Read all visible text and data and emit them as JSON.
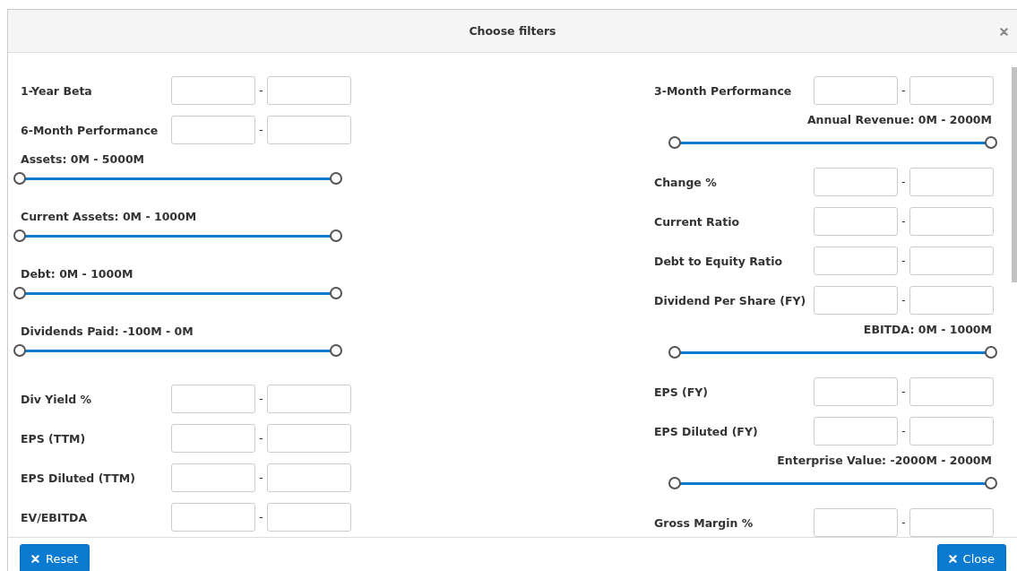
{
  "dialog": {
    "title": "Choose filters"
  },
  "columns": [
    {
      "filters": [
        {
          "kind": "range",
          "label": "1-Year Beta",
          "separator": "-"
        },
        {
          "kind": "range",
          "label": "6-Month Performance",
          "separator": "-"
        },
        {
          "kind": "slider",
          "label": "Assets: 0M - 5000M",
          "thumbs": [
            {
              "level": 0
            },
            {
              "level": 1
            }
          ]
        },
        {
          "kind": "slider",
          "label": "Current Assets: 0M - 1000M",
          "thumbs": [
            {
              "level": 0
            },
            {
              "level": 1
            }
          ]
        },
        {
          "kind": "slider",
          "label": "Debt: 0M - 1000M",
          "thumbs": [
            {
              "level": 0
            },
            {
              "level": 1
            }
          ]
        },
        {
          "kind": "slider",
          "label": "Dividends Paid: -100M - 0M",
          "thumbs": [
            {
              "level": 0
            },
            {
              "level": 1
            }
          ]
        },
        {
          "kind": "range",
          "label": "Div Yield %",
          "separator": "-"
        },
        {
          "kind": "range",
          "label": "EPS (TTM)",
          "separator": "-"
        },
        {
          "kind": "range",
          "label": "EPS Diluted (TTM)",
          "separator": "-"
        },
        {
          "kind": "range",
          "label": "EV/EBITDA",
          "separator": "-"
        }
      ]
    },
    {
      "filters": [
        {
          "kind": "range",
          "label": "3-Month Performance",
          "separator": "-"
        },
        {
          "kind": "slider",
          "label": "Annual Revenue: 0M - 2000M",
          "thumbs": [
            {
              "level": 0
            },
            {
              "level": 1
            }
          ]
        },
        {
          "kind": "range",
          "label": "Change %",
          "separator": "-"
        },
        {
          "kind": "range",
          "label": "Current Ratio",
          "separator": "-"
        },
        {
          "kind": "range",
          "label": "Debt to Equity Ratio",
          "separator": "-"
        },
        {
          "kind": "range",
          "label": "Dividend Per Share (FY)",
          "separator": "-"
        },
        {
          "kind": "slider",
          "label": "EBITDA: 0M - 1000M",
          "thumbs": [
            {
              "level": 0
            },
            {
              "level": 1
            }
          ]
        },
        {
          "kind": "range",
          "label": "EPS (FY)",
          "separator": "-"
        },
        {
          "kind": "range",
          "label": "EPS Diluted (FY)",
          "separator": "-"
        },
        {
          "kind": "slider",
          "label": "Enterprise Value: -2000M - 2000M",
          "thumbs": [
            {
              "level": 0
            },
            {
              "level": 1
            }
          ]
        },
        {
          "kind": "range",
          "label": "Gross Margin %",
          "separator": "-"
        }
      ]
    }
  ],
  "buttons": [
    {
      "label": "Reset"
    },
    {
      "label": "Close"
    }
  ]
}
